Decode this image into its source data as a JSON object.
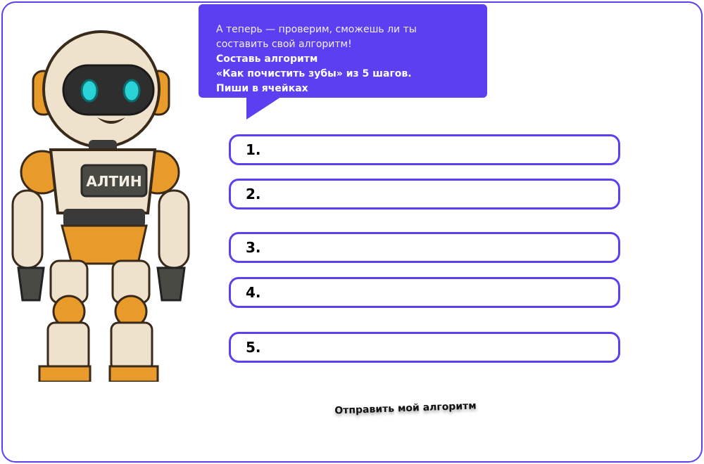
{
  "bubble": {
    "intro": "А теперь — проверим, сможешь ли ты составить свой алгоритм!",
    "task_line1": "Составь алгоритм",
    "task_line2": "«Как почистить зубы» из 5 шагов.",
    "task_line3": "Пиши в ячейках"
  },
  "robot": {
    "badge": "АЛТИН"
  },
  "steps": [
    {
      "label": "1.",
      "value": ""
    },
    {
      "label": "2.",
      "value": ""
    },
    {
      "label": "3.",
      "value": ""
    },
    {
      "label": "4.",
      "value": ""
    },
    {
      "label": "5.",
      "value": ""
    }
  ],
  "submit_label": "Отправить мой алгоритм",
  "colors": {
    "accent": "#5b3ff0",
    "robot_body": "#efe2cd",
    "robot_orange": "#e89a2a",
    "robot_dark": "#3a3a3a",
    "robot_eye": "#2ad4d6"
  }
}
